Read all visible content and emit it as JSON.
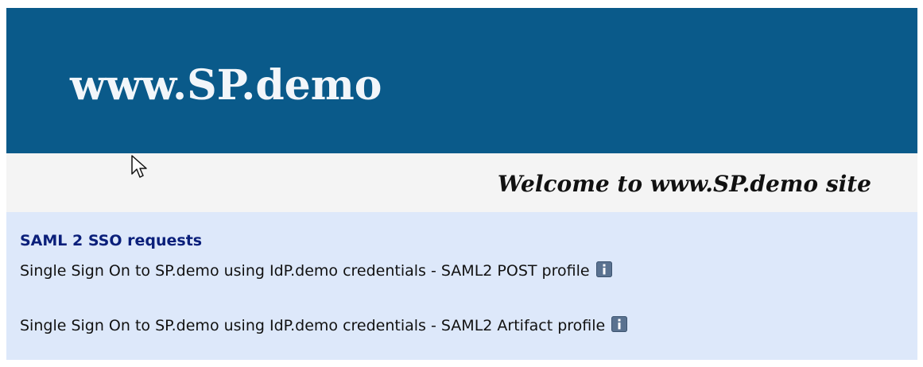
{
  "header": {
    "site_title": "www.SP.demo"
  },
  "welcome": {
    "text": "Welcome to www.SP.demo site"
  },
  "content": {
    "section_title": "SAML 2 SSO requests",
    "links": [
      {
        "label": "Single Sign On to SP.demo using IdP.demo credentials - SAML2 POST profile",
        "icon": "info-icon"
      },
      {
        "label": "Single Sign On to SP.demo using IdP.demo credentials - SAML2 Artifact profile",
        "icon": "info-icon"
      }
    ]
  },
  "colors": {
    "banner": "#0a5a8a",
    "welcome_bar": "#f4f4f4",
    "content_panel": "#dde8fa",
    "section_title": "#0a1f7a",
    "info_icon": "#5a7290"
  }
}
